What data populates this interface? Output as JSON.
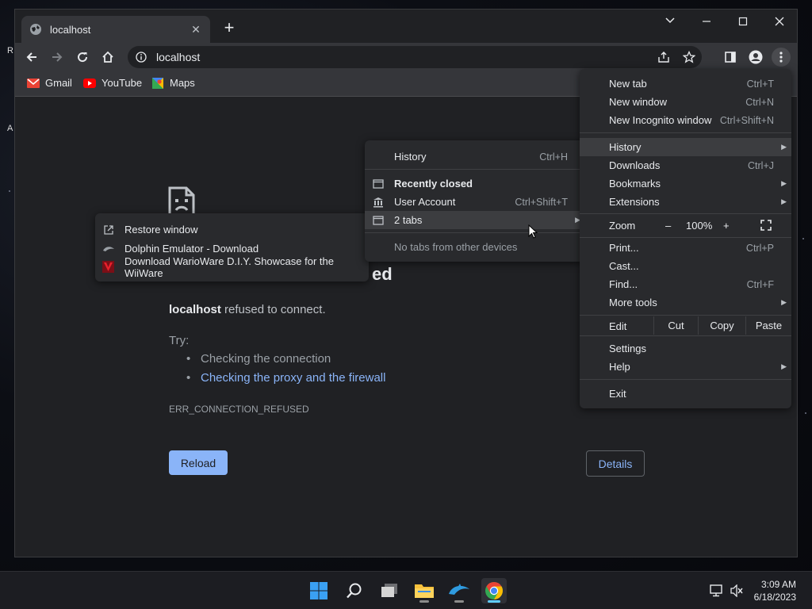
{
  "desktop": {
    "left_labels": [
      "R",
      "A"
    ]
  },
  "browser": {
    "tab": {
      "title": "localhost"
    },
    "address": {
      "url": "localhost"
    },
    "bookmarks": [
      {
        "label": "Gmail",
        "icon": "gmail-icon"
      },
      {
        "label": "YouTube",
        "icon": "youtube-icon"
      },
      {
        "label": "Maps",
        "icon": "maps-icon"
      }
    ]
  },
  "error_page": {
    "title_fragment": "ed",
    "host": "localhost",
    "message": " refused to connect.",
    "try_label": "Try:",
    "suggestions": [
      "Checking the connection",
      "Checking the proxy and the firewall"
    ],
    "error_code": "ERR_CONNECTION_REFUSED",
    "reload_label": "Reload",
    "details_label": "Details"
  },
  "main_menu": {
    "new_tab": {
      "label": "New tab",
      "shortcut": "Ctrl+T"
    },
    "new_window": {
      "label": "New window",
      "shortcut": "Ctrl+N"
    },
    "new_incognito": {
      "label": "New Incognito window",
      "shortcut": "Ctrl+Shift+N"
    },
    "history": {
      "label": "History"
    },
    "downloads": {
      "label": "Downloads",
      "shortcut": "Ctrl+J"
    },
    "bookmarks": {
      "label": "Bookmarks"
    },
    "extensions": {
      "label": "Extensions"
    },
    "zoom": {
      "label": "Zoom",
      "minus": "–",
      "value": "100%",
      "plus": "+"
    },
    "print": {
      "label": "Print...",
      "shortcut": "Ctrl+P"
    },
    "cast": {
      "label": "Cast..."
    },
    "find": {
      "label": "Find...",
      "shortcut": "Ctrl+F"
    },
    "more_tools": {
      "label": "More tools"
    },
    "edit": {
      "label": "Edit",
      "cut": "Cut",
      "copy": "Copy",
      "paste": "Paste"
    },
    "settings": {
      "label": "Settings"
    },
    "help": {
      "label": "Help"
    },
    "exit": {
      "label": "Exit"
    }
  },
  "history_menu": {
    "history": {
      "label": "History",
      "shortcut": "Ctrl+H"
    },
    "recently_closed": "Recently closed",
    "user_account": {
      "label": "User Account",
      "shortcut": "Ctrl+Shift+T"
    },
    "two_tabs": "2 tabs",
    "no_tabs": "No tabs from other devices"
  },
  "tabs_submenu": {
    "restore": "Restore window",
    "items": [
      "Dolphin Emulator - Download",
      "Download WarioWare D.I.Y. Showcase for the WiiWare"
    ]
  },
  "taskbar": {
    "time": "3:09 AM",
    "date": "6/18/2023"
  }
}
